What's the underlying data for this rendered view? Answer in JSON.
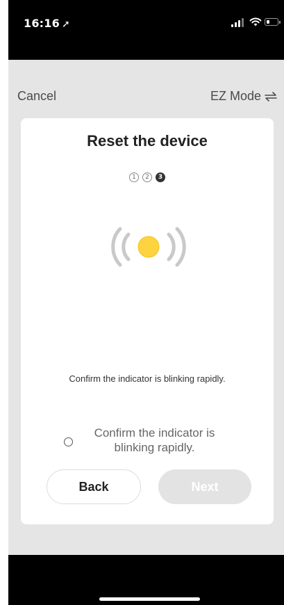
{
  "status_bar": {
    "time": "16:16",
    "location_icon": "location-arrow-icon",
    "signal_icon": "cellular-signal-icon",
    "wifi_icon": "wifi-icon",
    "battery_icon": "battery-icon",
    "battery_level": 0.35
  },
  "nav": {
    "cancel_label": "Cancel",
    "mode_label": "EZ Mode",
    "mode_icon": "swap-arrows-icon"
  },
  "card": {
    "title": "Reset the device",
    "steps": [
      {
        "label": "1",
        "active": false
      },
      {
        "label": "2",
        "active": false
      },
      {
        "label": "3",
        "active": true
      }
    ],
    "indicator_icon": "blinking-indicator-icon",
    "indicator_color": "#fdd33f",
    "instruction": "Confirm the indicator is blinking rapidly.",
    "checkbox_label": "Confirm the indicator is blinking rapidly.",
    "checkbox_checked": false,
    "back_label": "Back",
    "next_label": "Next",
    "next_enabled": false
  },
  "colors": {
    "sheet_bg": "#e5e5e5",
    "card_bg": "#ffffff",
    "next_disabled_bg": "#e3e3e3",
    "wave_color": "#c9c9c9"
  }
}
